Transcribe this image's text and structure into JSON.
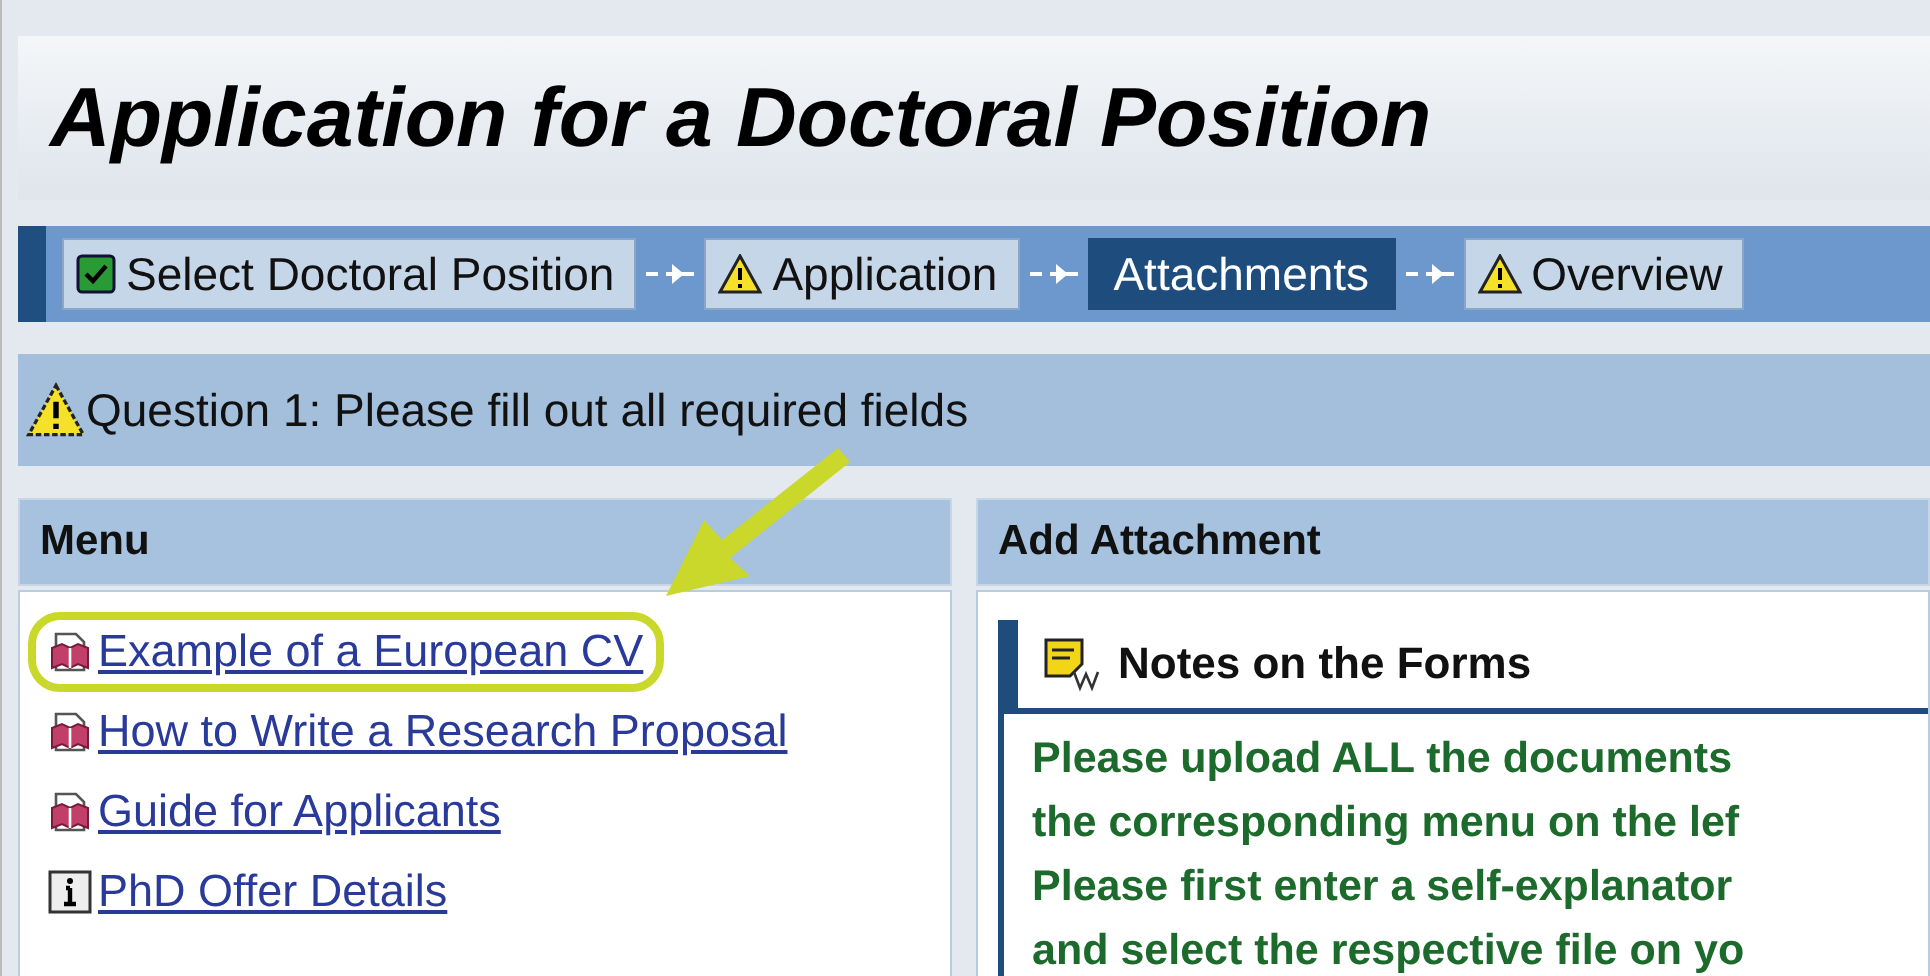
{
  "window": {
    "title": "Application for a Doctoral Position"
  },
  "steps": [
    {
      "label": "Select Doctoral Position",
      "kind": "done",
      "selected": false
    },
    {
      "label": "Application",
      "kind": "warning",
      "selected": false
    },
    {
      "label": "Attachments",
      "kind": "plain",
      "selected": true
    },
    {
      "label": "Overview",
      "kind": "warning",
      "selected": false
    }
  ],
  "message": {
    "text": "Question 1: Please fill out all required fields"
  },
  "menu": {
    "title": "Menu",
    "items": [
      {
        "label": "Example of a European CV",
        "kind": "book",
        "highlighted": true
      },
      {
        "label": "How to Write a Research Proposal",
        "kind": "book",
        "highlighted": false
      },
      {
        "label": "Guide for Applicants",
        "kind": "book",
        "highlighted": false
      },
      {
        "label": "PhD Offer Details",
        "kind": "info",
        "highlighted": false
      }
    ]
  },
  "attachment": {
    "title": "Add Attachment",
    "notes_title": "Notes on the Forms",
    "notes_lines": [
      "Please upload ALL the documents",
      "the corresponding menu on the lef",
      "Please first enter a self-explanator",
      "and select the respective file on yo"
    ]
  }
}
